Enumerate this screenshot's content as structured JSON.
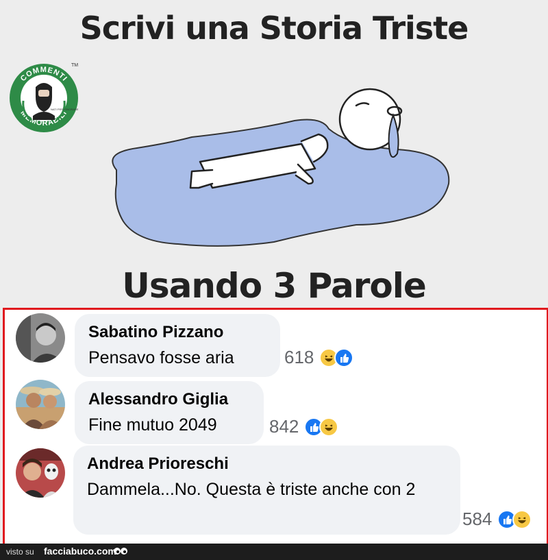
{
  "meme": {
    "title_top": "Scrivi una Storia Triste",
    "title_bottom": "Usando 3 Parole",
    "logo": {
      "text_top": "COMMENTI",
      "text_bottom": "MEMORABILI",
      "small_text": "NATI PER IGNORARE",
      "trademark": "TM",
      "color": "#2e8b47"
    },
    "puddle_color": "#a9bde8"
  },
  "comments": [
    {
      "author": "Sabatino Pizzano",
      "text": "Pensavo fosse aria",
      "count": "618",
      "reactions": [
        "haha-icon",
        "like-icon"
      ]
    },
    {
      "author": "Alessandro Giglia",
      "text": "Fine mutuo 2049",
      "count": "842",
      "reactions": [
        "like-icon",
        "haha-icon"
      ]
    },
    {
      "author": "Andrea Prioreschi",
      "text": "Dammela...No. Questa è triste anche con 2",
      "count": "584",
      "reactions": [
        "like-icon",
        "haha-icon"
      ]
    }
  ],
  "footer": {
    "visto_su": "visto su",
    "site": "facciabuco.com"
  },
  "colors": {
    "frame": "#e0191e",
    "like": "#1877f2",
    "haha": "#f7c844",
    "bubble": "#f0f2f5"
  }
}
